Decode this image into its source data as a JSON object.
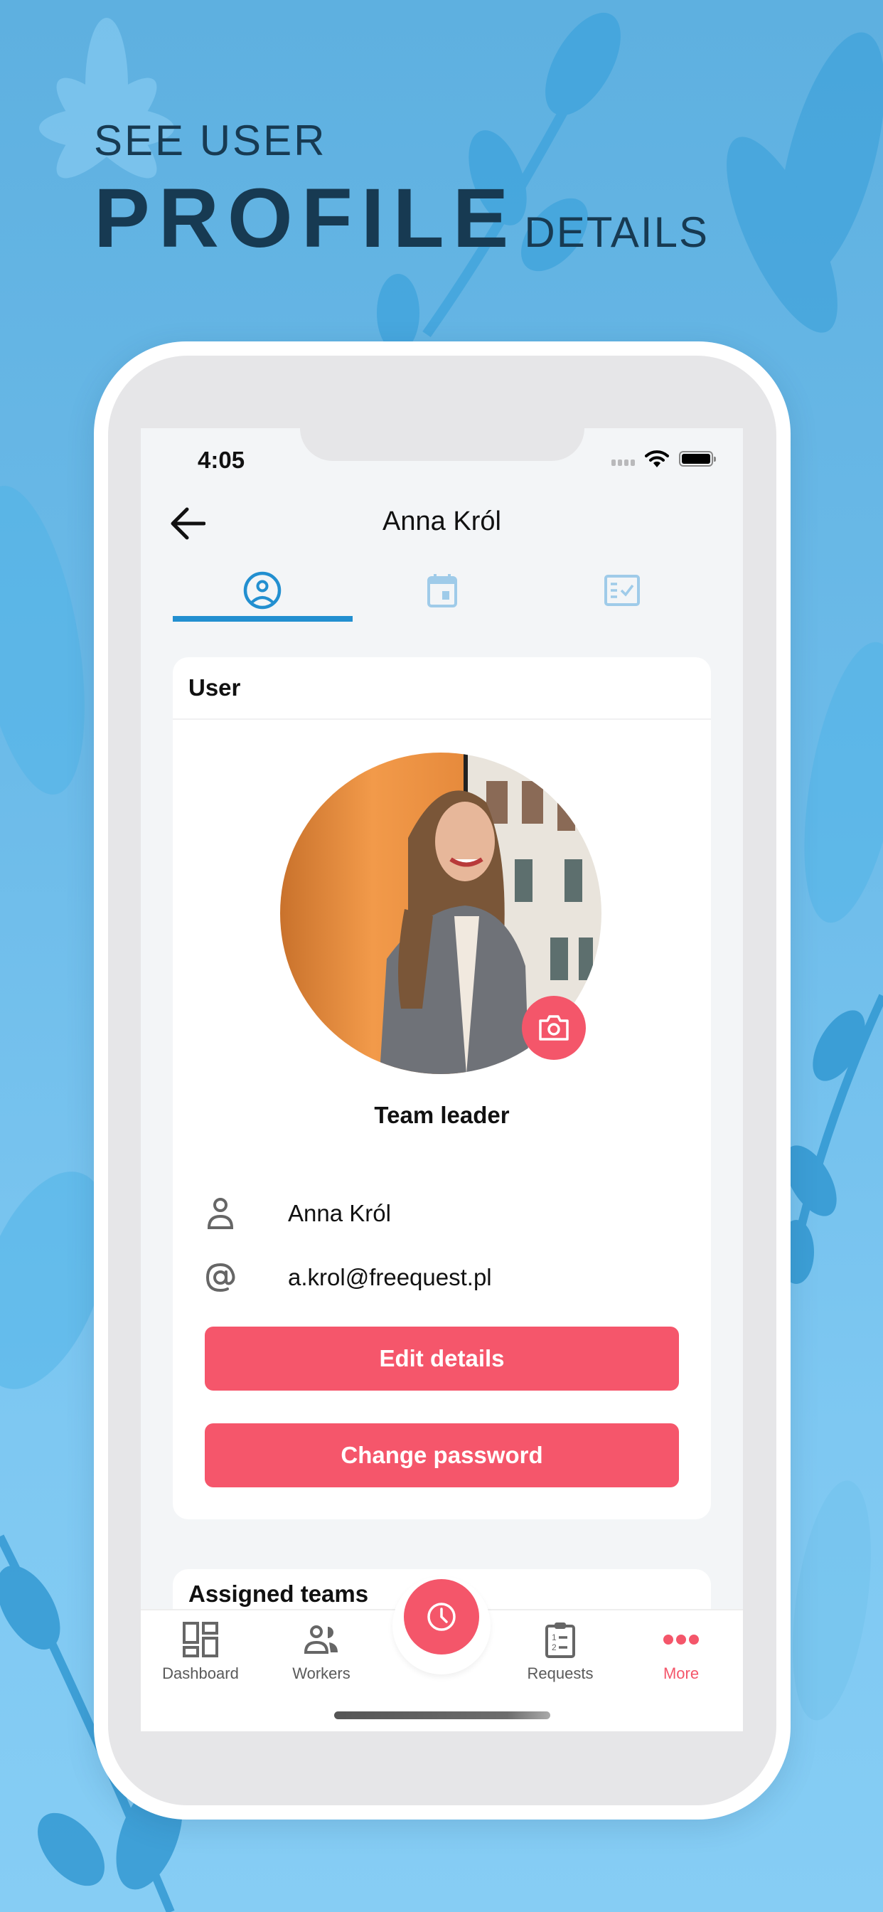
{
  "promo": {
    "line1": "SEE USER",
    "line2_big": "PROFILE",
    "line2_small": "DETAILS"
  },
  "colors": {
    "accent": "#f5566b",
    "tab_active": "#228fd0",
    "tab_inactive": "#9fcbe9",
    "headline": "#173a52"
  },
  "status_bar": {
    "time": "4:05"
  },
  "header": {
    "title": "Anna Król",
    "back_icon": "arrow-left-icon"
  },
  "tabs": [
    {
      "id": "profile",
      "icon": "user-circle-icon",
      "active": true
    },
    {
      "id": "calendar",
      "icon": "calendar-icon",
      "active": false
    },
    {
      "id": "tasks",
      "icon": "checklist-icon",
      "active": false
    }
  ],
  "user_card": {
    "title": "User",
    "role": "Team leader",
    "name": "Anna Król",
    "email": "a.krol@freequest.pl",
    "edit_button": "Edit details",
    "password_button": "Change password"
  },
  "teams_card": {
    "title": "Assigned teams"
  },
  "bottom_nav": {
    "items": [
      {
        "label": "Dashboard",
        "icon": "dashboard-icon",
        "active": false
      },
      {
        "label": "Workers",
        "icon": "workers-icon",
        "active": false
      },
      {
        "label": "Requests",
        "icon": "clipboard-list-icon",
        "active": false
      },
      {
        "label": "More",
        "icon": "more-dots-icon",
        "active": true
      }
    ],
    "fab_icon": "clock-icon"
  }
}
